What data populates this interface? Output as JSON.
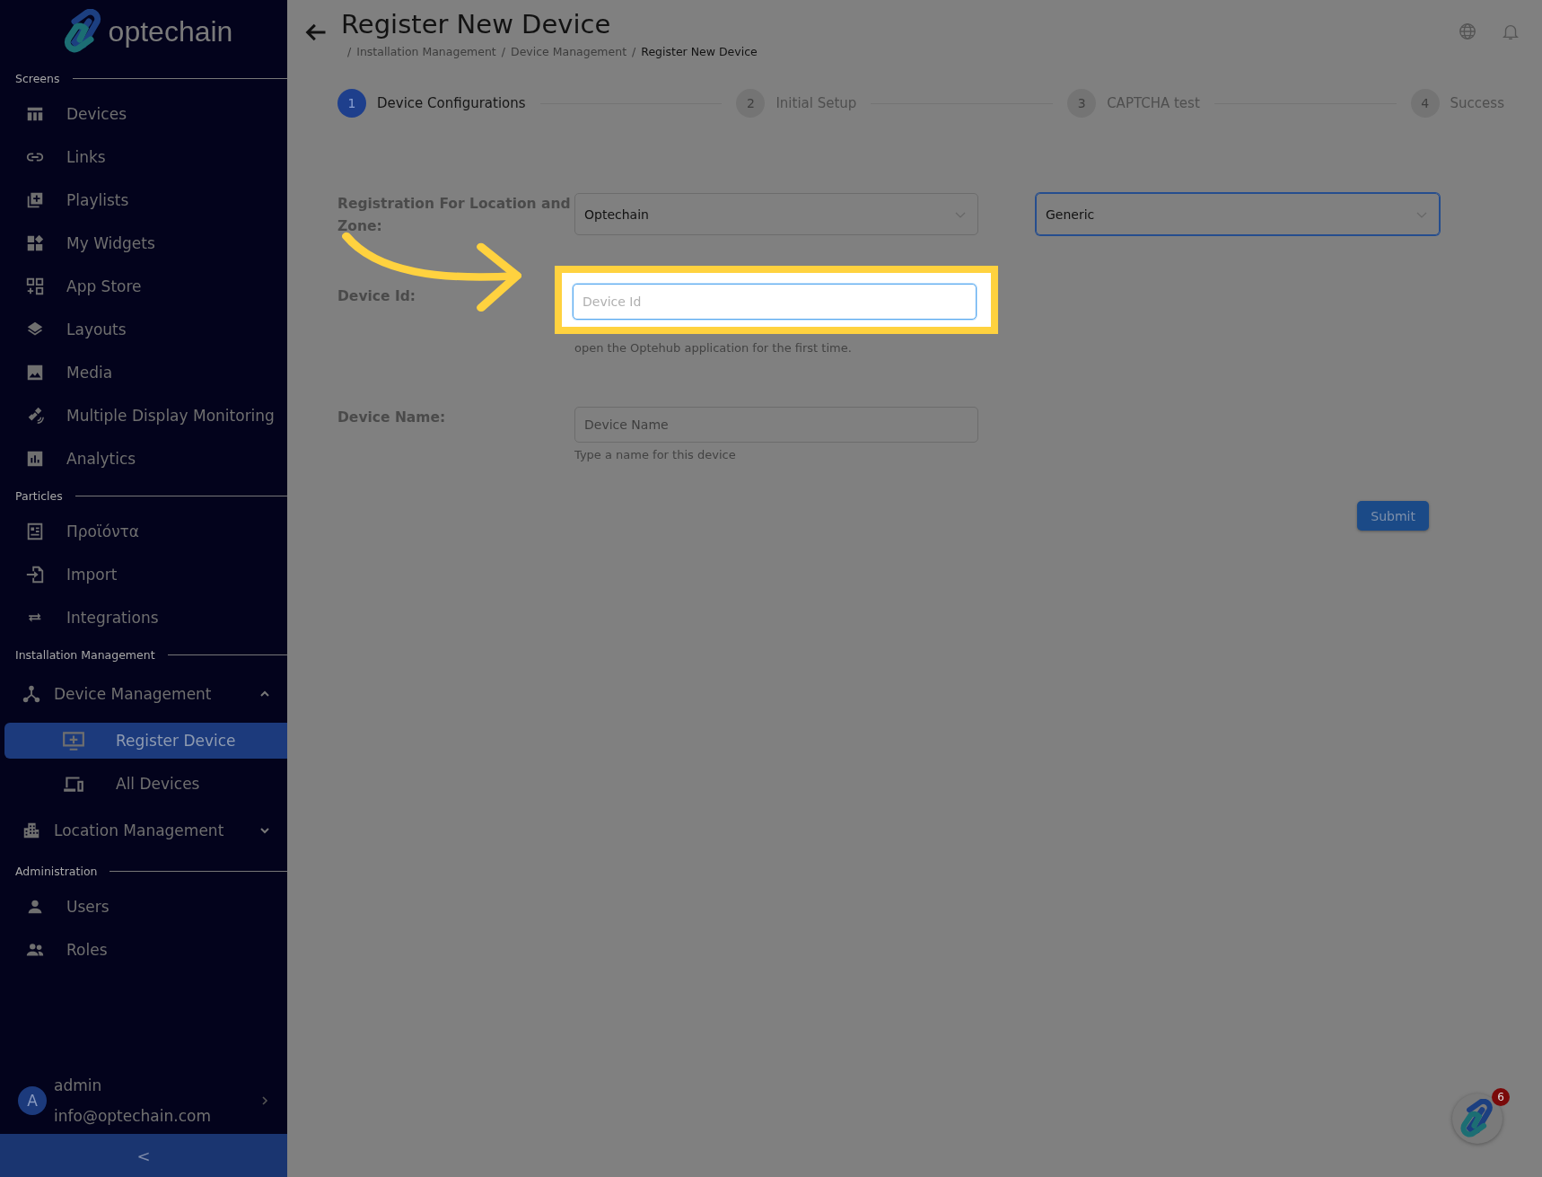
{
  "sidebar": {
    "logo": "optechain",
    "sections": [
      {
        "title": "Screens",
        "items": [
          {
            "label": "Devices",
            "kind": "link",
            "selected": false
          },
          {
            "label": "Links",
            "kind": "link",
            "selected": false
          },
          {
            "label": "Playlists",
            "kind": "link",
            "selected": false
          },
          {
            "label": "My Widgets",
            "kind": "link",
            "selected": false
          },
          {
            "label": "App Store",
            "kind": "link",
            "selected": false
          },
          {
            "label": "Layouts",
            "kind": "link",
            "selected": false
          },
          {
            "label": "Media",
            "kind": "link",
            "selected": false
          },
          {
            "label": "Multiple Display Monitoring",
            "kind": "link",
            "selected": false
          },
          {
            "label": "Analytics",
            "kind": "link",
            "selected": false
          }
        ]
      },
      {
        "title": "Particles",
        "items": [
          {
            "label": "Προϊόντα",
            "kind": "link",
            "selected": false
          },
          {
            "label": "Import",
            "kind": "link",
            "selected": false
          },
          {
            "label": "Integrations",
            "kind": "link",
            "selected": false
          }
        ]
      },
      {
        "title": "Installation Management",
        "items": [
          {
            "label": "Device Management",
            "kind": "group",
            "expanded": true,
            "children": [
              {
                "label": "Register Device",
                "selected": true
              },
              {
                "label": "All Devices",
                "selected": false
              }
            ]
          },
          {
            "label": "Location Management",
            "kind": "group",
            "expanded": false
          }
        ]
      },
      {
        "title": "Administration",
        "items": [
          {
            "label": "Users",
            "kind": "link",
            "selected": false
          },
          {
            "label": "Roles",
            "kind": "link",
            "selected": false
          }
        ]
      }
    ],
    "user": {
      "initial": "A",
      "name": "admin",
      "email": "info@optechain.com"
    },
    "collapse": "<"
  },
  "header": {
    "title": "Register New Device",
    "separator": "/",
    "breadcrumb": [
      {
        "label": "Installation Management",
        "current": false
      },
      {
        "label": "Device Management",
        "current": false
      },
      {
        "label": "Register New Device",
        "current": true
      }
    ]
  },
  "stepper": [
    {
      "number": "1",
      "label": "Device Configurations",
      "selected": true
    },
    {
      "number": "2",
      "label": "Initial Setup",
      "selected": false
    },
    {
      "number": "3",
      "label": "CAPTCHA test",
      "selected": false
    },
    {
      "number": "4",
      "label": "Success",
      "selected": false
    }
  ],
  "form": {
    "rows": [
      {
        "kind": "selects",
        "label": "Registration For Location and Zone:",
        "selects": [
          {
            "value": "Optechain",
            "focused": false
          },
          {
            "value": "Generic",
            "focused": true
          }
        ]
      },
      {
        "kind": "input",
        "label": "Device Id:",
        "placeholder": "Device Id",
        "highlighted": true,
        "help": "open the Optehub application for the first time."
      },
      {
        "kind": "input",
        "label": "Device Name:",
        "placeholder": "Device Name",
        "highlighted": false,
        "help": "Type a name for this device"
      }
    ],
    "submit": "Submit"
  },
  "chat": {
    "badge": "6"
  }
}
